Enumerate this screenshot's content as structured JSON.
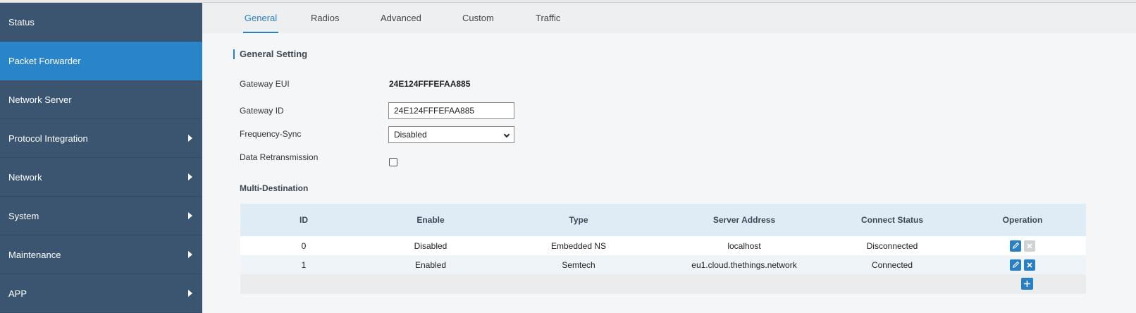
{
  "sidebar": {
    "items": [
      {
        "label": "Status",
        "has_submenu": false,
        "active": false
      },
      {
        "label": "Packet Forwarder",
        "has_submenu": false,
        "active": true
      },
      {
        "label": "Network Server",
        "has_submenu": false,
        "active": false
      },
      {
        "label": "Protocol Integration",
        "has_submenu": true,
        "active": false
      },
      {
        "label": "Network",
        "has_submenu": true,
        "active": false
      },
      {
        "label": "System",
        "has_submenu": true,
        "active": false
      },
      {
        "label": "Maintenance",
        "has_submenu": true,
        "active": false
      },
      {
        "label": "APP",
        "has_submenu": true,
        "active": false
      }
    ]
  },
  "tabs": [
    {
      "label": "General",
      "active": true
    },
    {
      "label": "Radios",
      "active": false
    },
    {
      "label": "Advanced",
      "active": false
    },
    {
      "label": "Custom",
      "active": false
    },
    {
      "label": "Traffic",
      "active": false
    }
  ],
  "general": {
    "section_title": "General Setting",
    "gateway_eui_label": "Gateway EUI",
    "gateway_eui_value": "24E124FFFEFAA885",
    "gateway_id_label": "Gateway ID",
    "gateway_id_value": "24E124FFFEFAA885",
    "freq_sync_label": "Frequency-Sync",
    "freq_sync_value": "Disabled",
    "data_retx_label": "Data Retransmission",
    "data_retx_checked": false
  },
  "multi_destination": {
    "title": "Multi-Destination",
    "headers": [
      "ID",
      "Enable",
      "Type",
      "Server Address",
      "Connect Status",
      "Operation"
    ],
    "rows": [
      {
        "id": "0",
        "enable": "Disabled",
        "type": "Embedded NS",
        "server": "localhost",
        "status": "Disconnected",
        "delete_enabled": false
      },
      {
        "id": "1",
        "enable": "Enabled",
        "type": "Semtech",
        "server": "eu1.cloud.thethings.network",
        "status": "Connected",
        "delete_enabled": true
      }
    ]
  },
  "colors": {
    "sidebar_bg": "#3b5571",
    "sidebar_active": "#2a84c8",
    "accent": "#2a7fc2",
    "table_header_bg": "#dfebf5"
  }
}
